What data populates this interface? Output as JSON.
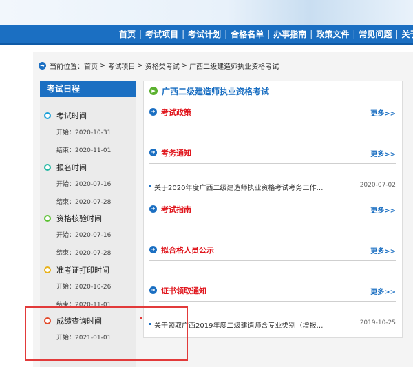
{
  "nav": {
    "items": [
      "首页",
      "考试项目",
      "考试计划",
      "合格名单",
      "办事指南",
      "政策文件",
      "常见问题",
      "关于"
    ],
    "separator": "|"
  },
  "breadcrumb": {
    "prefix": "当前位置：",
    "links": [
      "首页",
      "考试项目",
      "资格类考试",
      "广西二级建造师执业资格考试"
    ],
    "separator": ">"
  },
  "sidebar": {
    "title": "考试日程",
    "items": [
      {
        "name": "考试时间",
        "start": "开始：2020-10-31",
        "end": "结束：2020-11-01",
        "dot_color": "#1aa0d8"
      },
      {
        "name": "报名时间",
        "start": "开始：2020-07-16",
        "end": "结束：2020-07-28",
        "dot_color": "#22b7a2"
      },
      {
        "name": "资格核验时间",
        "start": "开始：2020-07-16",
        "end": "结束：2020-07-28",
        "dot_color": "#5cc134"
      },
      {
        "name": "准考证打印时间",
        "start": "开始：2020-10-26",
        "end": "结束：2020-11-01",
        "dot_color": "#e8b21c"
      },
      {
        "name": "成绩查询时间",
        "start": "开始：2021-01-01",
        "end": "",
        "dot_color": "#e24b2c"
      }
    ]
  },
  "main": {
    "title": "广西二级建造师执业资格考试",
    "more_label": "更多>>",
    "sections": [
      {
        "title": "考试政策",
        "items": []
      },
      {
        "title": "考务通知",
        "items": [
          {
            "text": "关于2020年度广西二级建造师执业资格考试考务工作…",
            "date": "2020-07-02"
          }
        ]
      },
      {
        "title": "考试指南",
        "items": []
      },
      {
        "title": "拟合格人员公示",
        "items": []
      },
      {
        "title": "证书领取通知",
        "items": [
          {
            "text": "关于领取广西2019年度二级建造师含专业类别（增报…",
            "date": "2019-10-25"
          }
        ]
      }
    ]
  },
  "colors": {
    "nav_bg": "#1b6fc2",
    "accent_red": "#e0161d",
    "highlight_box": "#e23a3a"
  }
}
